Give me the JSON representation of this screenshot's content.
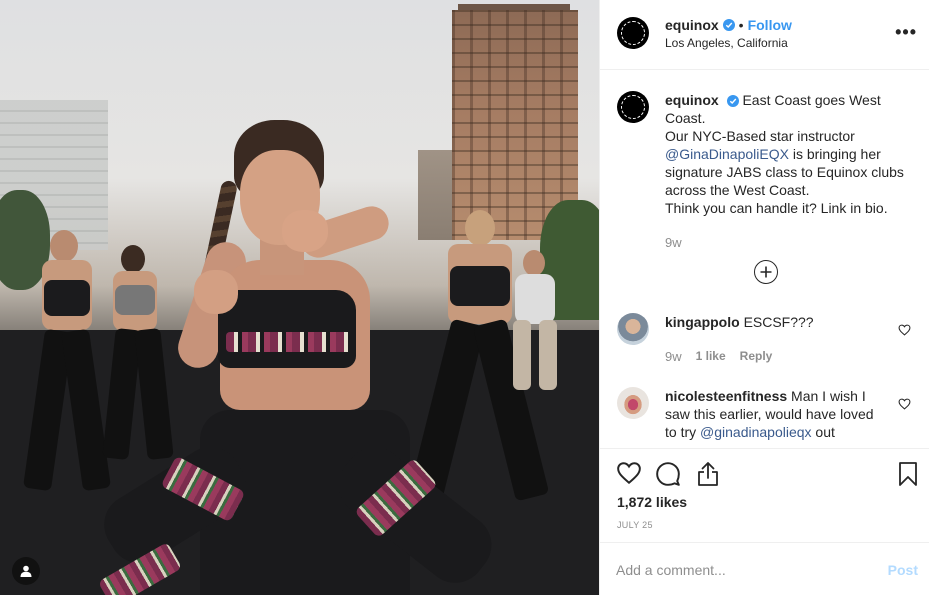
{
  "post": {
    "account": "equinox",
    "follow_label": "Follow",
    "separator": "•",
    "location": "Los Angeles, California",
    "more_label": "•••"
  },
  "caption": {
    "username": "equinox",
    "lines": [
      "East Coast goes West Coast.",
      "Our NYC-Based star instructor",
      "@GinaDinapoliEQX",
      " is bringing her",
      "signature JABS class to Equinox clubs",
      "across the West Coast.",
      "Think you can handle it? Link in bio."
    ],
    "time": "9w"
  },
  "comments": [
    {
      "username": "kingappolo",
      "text": "ESCSF???",
      "time": "9w",
      "likes": "1 like",
      "reply": "Reply"
    },
    {
      "username": "nicolesteenfitness",
      "text_lines": [
        "Man I wish I",
        "saw this earlier, would have loved",
        "to try "
      ],
      "mention": "@ginadinapolieqx",
      "tail": " out"
    }
  ],
  "engagement": {
    "likes": "1,872 likes",
    "date": "JULY 25"
  },
  "composer": {
    "placeholder": "Add a comment...",
    "post_label": "Post"
  },
  "colors": {
    "link": "#3897f0",
    "verified": "#3897f0",
    "muted": "#8e8e8e",
    "post_disabled": "#b3dbff"
  },
  "icons": [
    "verified-badge-icon",
    "more-icon",
    "load-more-icon",
    "heart-icon",
    "comment-icon",
    "share-icon",
    "bookmark-icon",
    "user-tag-icon"
  ]
}
